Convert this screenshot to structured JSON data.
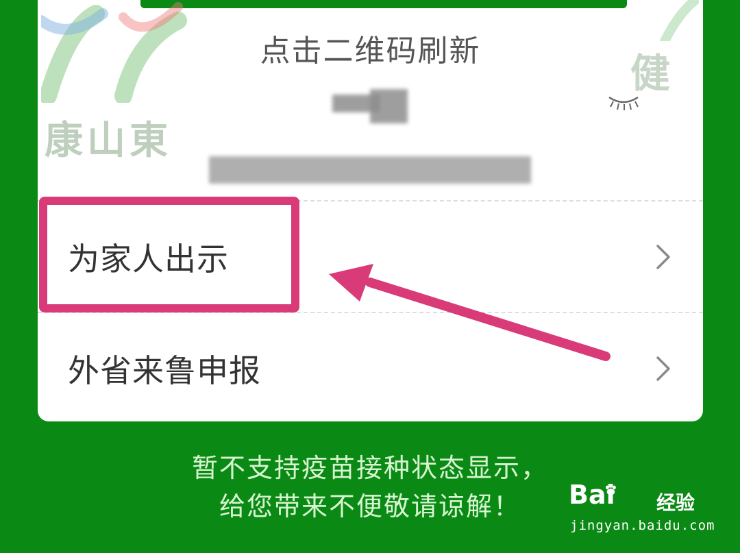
{
  "card": {
    "refresh_hint": "点击二维码刷新",
    "watermark_left": "康山東",
    "watermark_right": "健"
  },
  "menu": [
    {
      "label": "为家人出示"
    },
    {
      "label": "外省来鲁申报"
    }
  ],
  "footer": {
    "line1": "暂不支持疫苗接种状态显示，",
    "line2": "给您带来不便敬请谅解！"
  },
  "watermark": {
    "brand": "Bai",
    "brand_cn": "经验",
    "url": "jingyan.baidu.com"
  },
  "colors": {
    "background": "#0a8a14",
    "highlight": "#d93a78",
    "card": "#ffffff"
  }
}
